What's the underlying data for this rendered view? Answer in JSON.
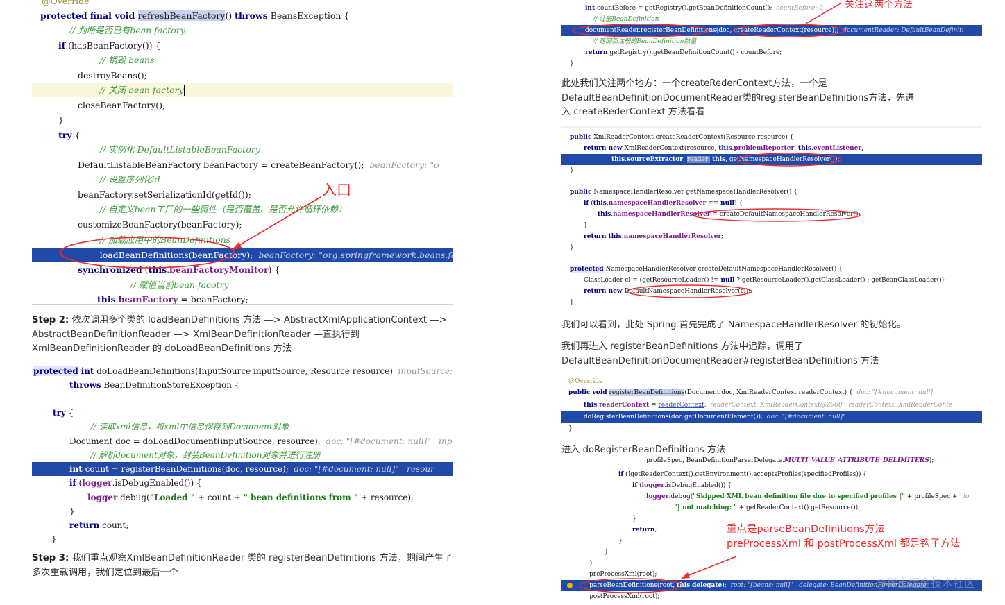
{
  "left": {
    "code1": [
      "@Override",
      "protected final void refreshBeanFactory() throws BeansException {",
      "    // 判断是否已有bean factory",
      "    if (hasBeanFactory()) {",
      "        // 销毁 beans",
      "        destroyBeans();",
      "        // 关闭 bean factory",
      "        closeBeanFactory();",
      "    }",
      "    try {",
      "        // 实例化 DefaultListableBeanFactory",
      "        DefaultListableBeanFactory beanFactory = createBeanFactory();",
      "        // 设置序列化id",
      "        beanFactory.setSerializationId(getId());",
      "        // 自定义bean工厂的一些属性（是否覆盖、是否允许循环依赖）",
      "        customizeBeanFactory(beanFactory);",
      "        // 加载应用中的BeanDefinitions",
      "        loadBeanDefinitions(beanFactory);",
      "        synchronized (this.beanFactoryMonitor) {",
      "            // 赋值当前bean facotry",
      "            this.beanFactory = beanFactory;"
    ],
    "code1_hint_create": "beanFactory: \"o",
    "code1_hint_load": "beanFactory: \"org.springframework.beans.fac",
    "entry_annotation": "入口",
    "step2": {
      "label": "Step 2:",
      "text": "依次调用多个类的 loadBeanDefinitions 方法 —> AbstractXmlApplicationContext —> AbstractBeanDefinitionReader —> XmlBeanDefinitionReader —直执行到 XmlBeanDefinitionReader 的 doLoadBeanDefinitions 方法"
    },
    "code2": [
      "protected int doLoadBeanDefinitions(InputSource inputSource, Resource resource)",
      "        throws BeanDefinitionStoreException {",
      "",
      "    try {",
      "        // 读取xml信息，将xml中信息保存到Document对象",
      "        Document doc = doLoadDocument(inputSource, resource);",
      "        // 解析document对象，封装BeanDefinition对象并进行注册",
      "        int count = registerBeanDefinitions(doc, resource);",
      "        if (logger.isDebugEnabled()) {",
      "            logger.debug(\"Loaded \" + count + \" bean definitions from \" + resource);",
      "        }",
      "        return count;",
      "    }"
    ],
    "code2_hint_first": "inputSource: ",
    "code2_hint_doc": "doc: \"[#document: null]\"   inpu",
    "code2_hint_count": "doc: \"[#document: null]\"   resour",
    "step3": {
      "label": "Step 3:",
      "text": "我们重点观察XmlBeanDefinitionReader 类的 registerBeanDefinitions 方法，期间产生了多次重载调用，我们定位到最后一个"
    }
  },
  "right": {
    "code1": [
      "    int countBefore = getRegistry().getBeanDefinitionCount();",
      "    // 注册BeanDefinition",
      "    documentReader.registerBeanDefinitions(doc, createReaderContext(resource));",
      "    // 返回新注册的BeanDefinition数量",
      "    return getRegistry().getBeanDefinitionCount() - countBefore;",
      "}"
    ],
    "code1_hint_count": "countBefore: 0",
    "code1_hint_doc": "documentReader: DefaultBeanDefiniti",
    "focus_annotation": "关注这两个方法",
    "para1": "此处我们关注两个地方：一个createRederContext方法，一个是 DefaultBeanDefinitionDocumentReader类的registerBeanDefinitions方法，先进入 createRederContext 方法看看",
    "code2": [
      "public XmlReaderContext createReaderContext(Resource resource) {",
      "    return new XmlReaderContext(resource, this.problemReporter, this.eventListener,",
      "            this.sourceExtractor, reader: this, getNamespaceHandlerResolver());",
      "}",
      "",
      "public NamespaceHandlerResolver getNamespaceHandlerResolver() {",
      "    if (this.namespaceHandlerResolver == null) {",
      "        this.namespaceHandlerResolver = createDefaultNamespaceHandlerResolver();",
      "    }",
      "    return this.namespaceHandlerResolver;",
      "}",
      "",
      "protected NamespaceHandlerResolver createDefaultNamespaceHandlerResolver() {",
      "    ClassLoader cl = (getResourceLoader() != null ? getResourceLoader().getClassLoader() : getBeanClassLoader());",
      "    return new DefaultNamespaceHandlerResolver(cl);",
      "}"
    ],
    "para2": "我们可以看到，此处 Spring 首先完成了 NamespaceHandlerResolver 的初始化。",
    "para3": "我们再进入 registerBeanDefinitions 方法中追踪，调用了 DefaultBeanDefinitionDocumentReader#registerBeanDefinitions 方法",
    "code3": [
      "@Override",
      "public void registerBeanDefinitions(Document doc, XmlReaderContext readerContext) {",
      "    this.readerContext = readerContext;",
      "    doRegisterBeanDefinitions(doc.getDocumentElement());",
      "}"
    ],
    "code3_hint_sig": "doc: \"[#document: null]",
    "code3_hint_ctx": "readerContext: XmlReaderContext@2900   readerContext: XmlReaderConte",
    "code3_hint_do": "doc: \"[#document: null]\"",
    "para4": "进入 doRegisterBeanDefinitions 方法",
    "code4": [
      "            profileSpec, BeanDefinitionParserDelegate.MULTI_VALUE_ATTRIBUTE_DELIMITERS);",
      "    if (!getReaderContext().getEnvironment().acceptsProfiles(specifiedProfiles)) {",
      "        if (logger.isDebugEnabled()) {",
      "            logger.debug(\"Skipped XML bean definition file due to specified profiles [\" + profileSpec +",
      "                    \"] not matching: \" + getReaderContext().getResource());",
      "        }",
      "        return;",
      "    }",
      "  }",
      "}",
      "",
      "preProcessXml(root);",
      "parseBeanDefinitions(root, this.delegate);",
      "postProcessXml(root);"
    ],
    "code4_hint_debug": "lo",
    "code4_hint_parse": "root: \"[beans: null]\"   delegate: BeanDefinitionParserDelegate",
    "key_annotation_line1": "重点是parseBeanDefinitions方法",
    "key_annotation_line2": "preProcessXml 和 postProcessXml 都是钩子方法",
    "watermark": "@稀土掘金技术社区"
  },
  "colors": {
    "highlight": "#2149a8",
    "keyword": "#000080",
    "comment": "#3d9a3d",
    "annotation": "#ee2a2a"
  }
}
